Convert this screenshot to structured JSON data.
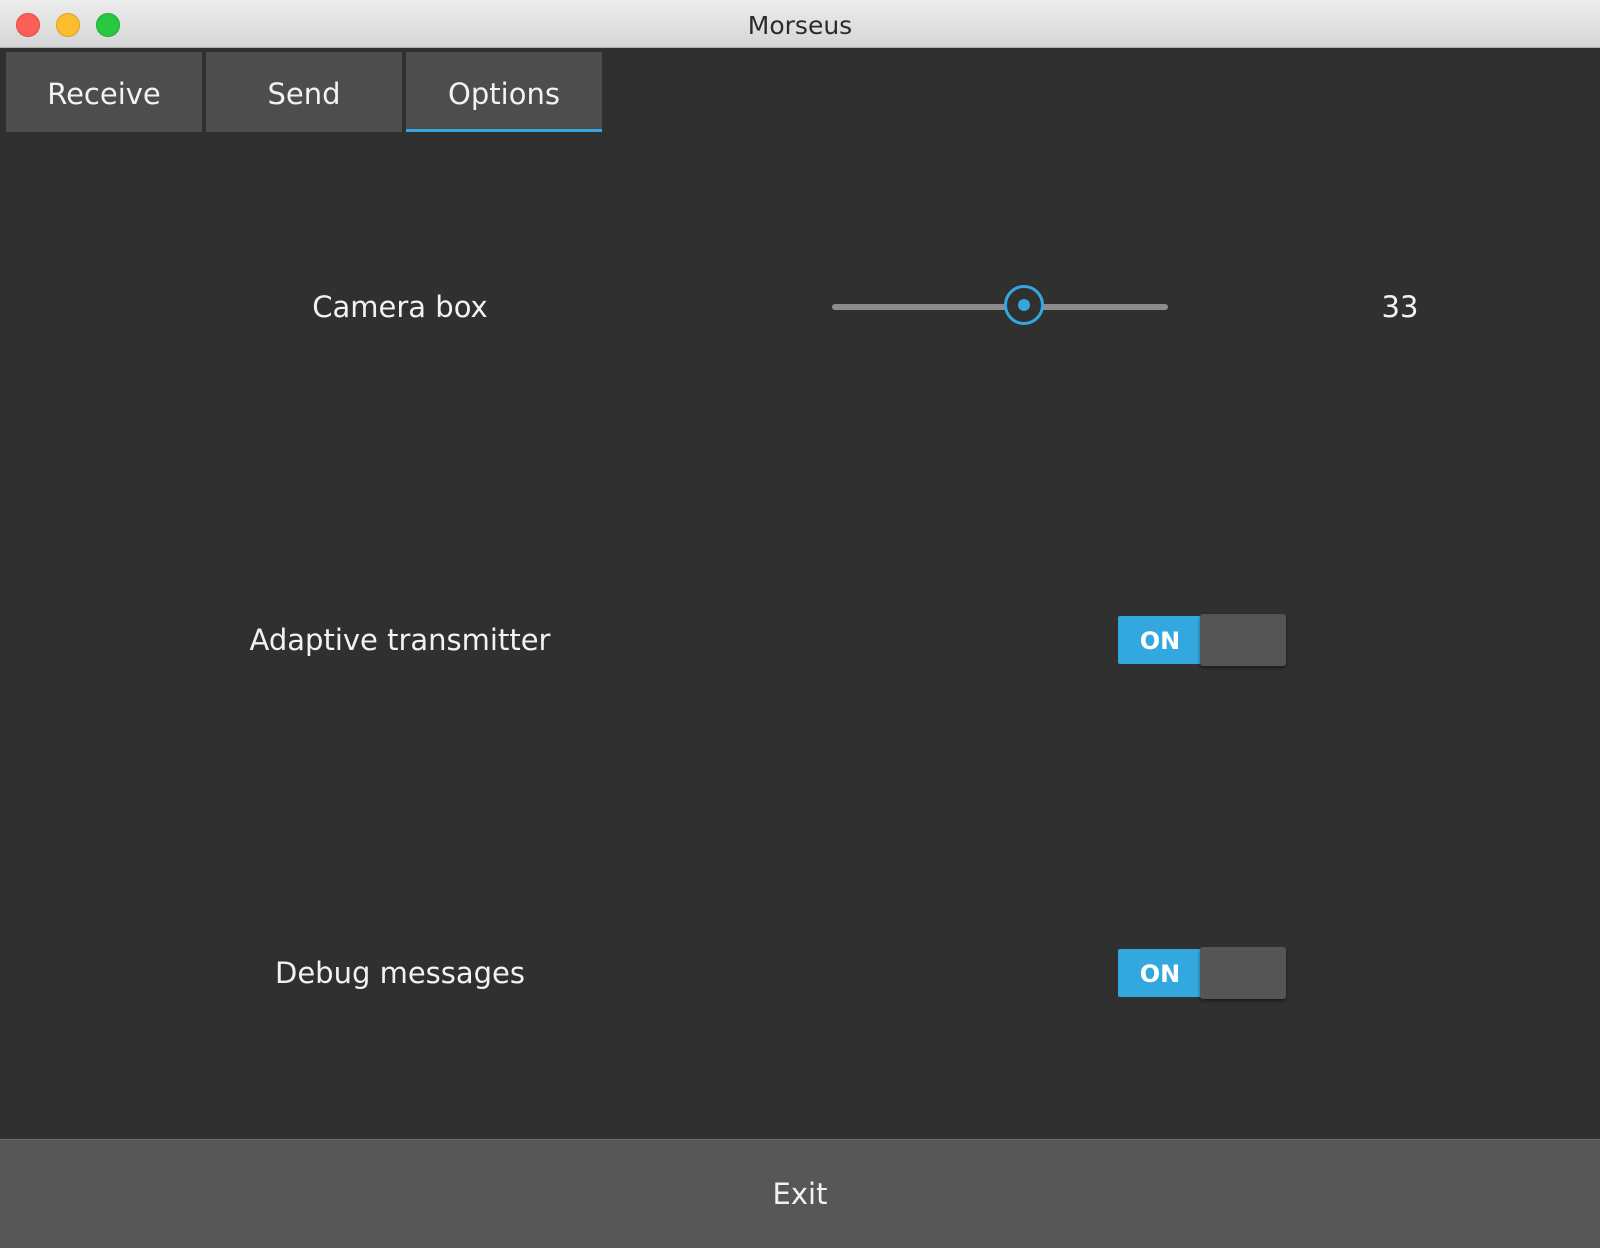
{
  "window": {
    "title": "Morseus"
  },
  "tabs": [
    {
      "label": "Receive",
      "active": false
    },
    {
      "label": "Send",
      "active": false
    },
    {
      "label": "Options",
      "active": true
    }
  ],
  "options": {
    "camera_box": {
      "label": "Camera box",
      "value": "33",
      "slider_fraction": 0.57
    },
    "adaptive_transmitter": {
      "label": "Adaptive transmitter",
      "state_label": "ON",
      "enabled": true
    },
    "debug_messages": {
      "label": "Debug messages",
      "state_label": "ON",
      "enabled": true
    }
  },
  "footer": {
    "exit_label": "Exit"
  },
  "colors": {
    "accent": "#33a8df",
    "background": "#303030",
    "tab_background": "#4d4d4d",
    "button_background": "#575757"
  }
}
